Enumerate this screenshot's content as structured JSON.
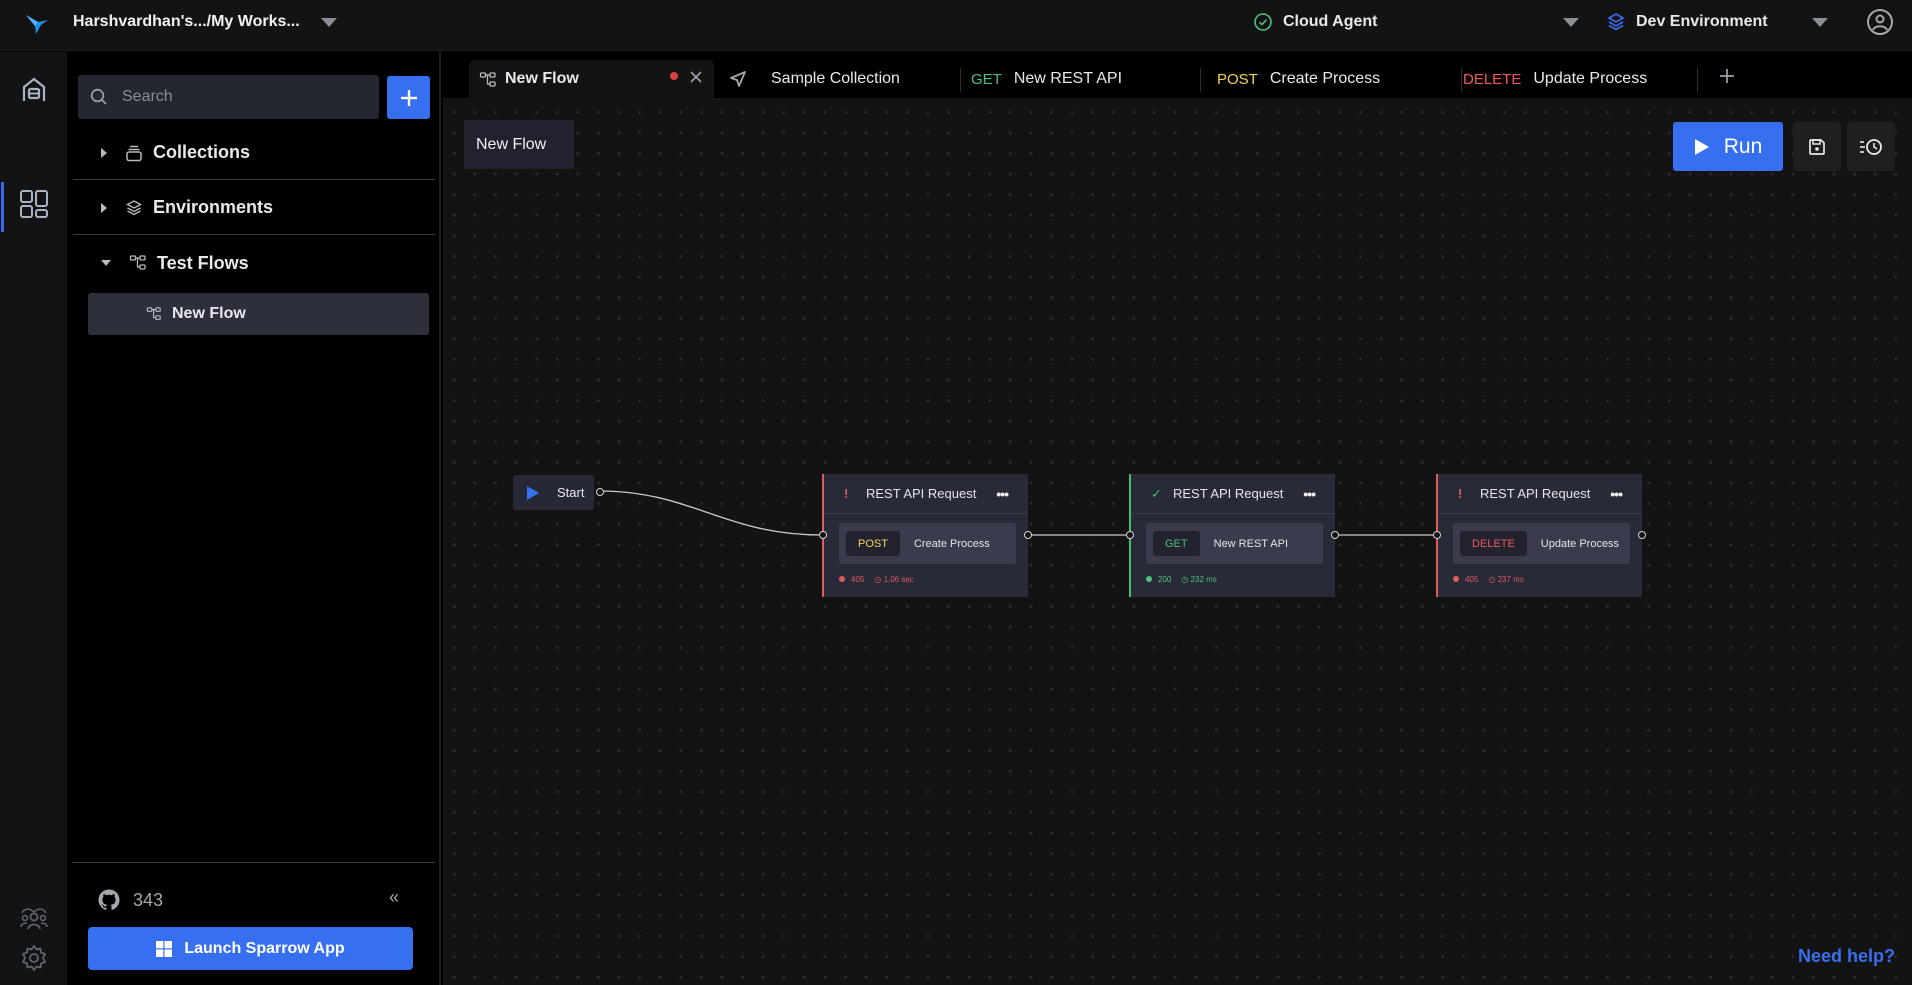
{
  "topbar": {
    "workspace": "Harshvardhan's.../My Works...",
    "agent": "Cloud Agent",
    "environment": "Dev Environment"
  },
  "rail": {
    "items": [
      {
        "name": "home",
        "icon": "home-icon"
      },
      {
        "name": "workspace",
        "icon": "grid-icon",
        "active": true
      },
      {
        "name": "team",
        "icon": "team-icon"
      },
      {
        "name": "settings",
        "icon": "gear-icon"
      }
    ]
  },
  "sidebar": {
    "search_placeholder": "Search",
    "sections": [
      {
        "label": "Collections",
        "expanded": false,
        "icon": "collection-icon"
      },
      {
        "label": "Environments",
        "expanded": false,
        "icon": "layers-icon"
      },
      {
        "label": "Test Flows",
        "expanded": true,
        "icon": "flow-icon"
      }
    ],
    "flows": [
      {
        "label": "New Flow"
      }
    ],
    "github_stars": "343",
    "collapse_glyph": "«",
    "launch_label": "Launch Sparrow App"
  },
  "tabs": [
    {
      "label": "New Flow",
      "type": "flow",
      "active": true,
      "unsaved": true
    },
    {
      "label": "Sample Collection",
      "type": "collection"
    },
    {
      "label": "New REST API",
      "method": "GET"
    },
    {
      "label": "Create Process",
      "method": "POST"
    },
    {
      "label": "Update Process",
      "method": "DELETE"
    }
  ],
  "colors": {
    "accent": "#3670f0",
    "get": "#4fc17e",
    "post": "#f2d45c",
    "delete": "#f05a5a",
    "error": "#e05c5c",
    "success": "#3fbf6f"
  },
  "canvas": {
    "flow_name": "New Flow",
    "run_label": "Run",
    "start_label": "Start",
    "nodes": [
      {
        "title": "REST API Request",
        "status": "error",
        "status_glyph": "!",
        "method": "POST",
        "name": "Create Process",
        "code": "405",
        "time": "1.06 sec"
      },
      {
        "title": "REST API Request",
        "status": "success",
        "status_glyph": "✓",
        "method": "GET",
        "name": "New REST API",
        "code": "200",
        "time": "232 ms"
      },
      {
        "title": "REST API Request",
        "status": "error",
        "status_glyph": "!",
        "method": "DELETE",
        "name": "Update Process",
        "code": "405",
        "time": "237 ms"
      }
    ],
    "menu_glyph": "•••"
  },
  "help_label": "Need help?"
}
